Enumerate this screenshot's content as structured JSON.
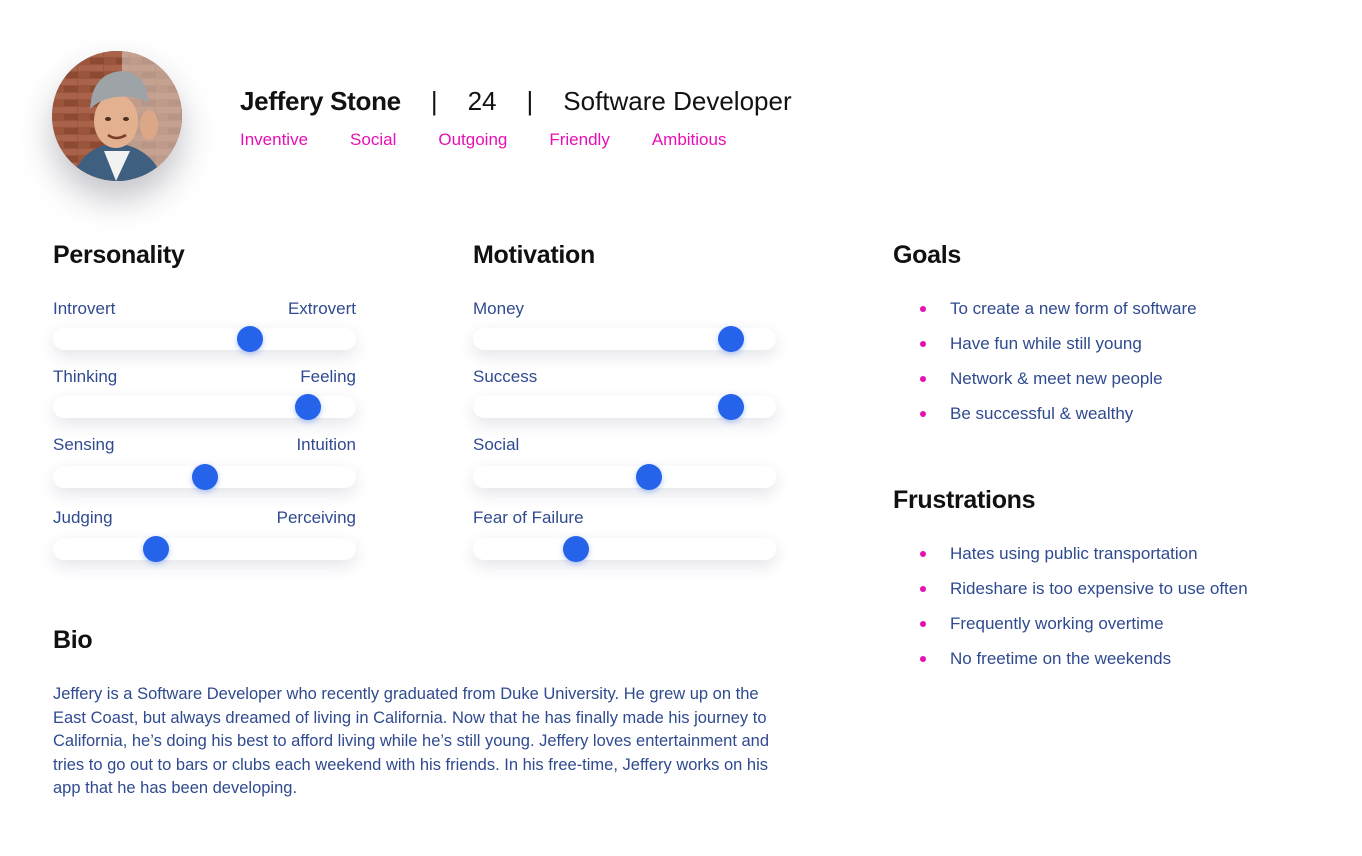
{
  "colors": {
    "accent": "#e810b4",
    "text_blue": "#2f4a8f",
    "knob": "#2563eb",
    "heading": "#111111"
  },
  "profile": {
    "name": "Jeffery Stone",
    "separator": "|",
    "age": "24",
    "occupation": "Software Developer",
    "traits": [
      "Inventive",
      "Social",
      "Outgoing",
      "Friendly",
      "Ambitious"
    ]
  },
  "personality": {
    "title": "Personality",
    "sliders": [
      {
        "left": "Introvert",
        "right": "Extrovert",
        "value": 0.65
      },
      {
        "left": "Thinking",
        "right": "Feeling",
        "value": 0.84
      },
      {
        "left": "Sensing",
        "right": "Intuition",
        "value": 0.5
      },
      {
        "left": "Judging",
        "right": "Perceiving",
        "value": 0.34
      }
    ]
  },
  "motivation": {
    "title": "Motivation",
    "sliders": [
      {
        "left": "Money",
        "right": "",
        "value": 0.85
      },
      {
        "left": "Success",
        "right": "",
        "value": 0.85
      },
      {
        "left": "Social",
        "right": "",
        "value": 0.58
      },
      {
        "left": "Fear of Failure",
        "right": "",
        "value": 0.34
      }
    ]
  },
  "goals": {
    "title": "Goals",
    "items": [
      "To create a new form of software",
      "Have fun while still young",
      "Network & meet new people",
      "Be successful & wealthy"
    ]
  },
  "frustrations": {
    "title": "Frustrations",
    "items": [
      "Hates using public transportation",
      "Rideshare is too expensive to use often",
      "Frequently working overtime",
      "No freetime on the weekends"
    ]
  },
  "bio": {
    "title": "Bio",
    "text": "Jeffery is a Software Developer who recently graduated from Duke University. He grew up on the East Coast, but always dreamed of living in California. Now that he has finally made his journey to California, he’s doing his best to afford living while he’s still young. Jeffery loves entertainment and tries to go out to bars or clubs each weekend with his friends. In his free-time, Jeffery works on his app that he has been developing."
  }
}
